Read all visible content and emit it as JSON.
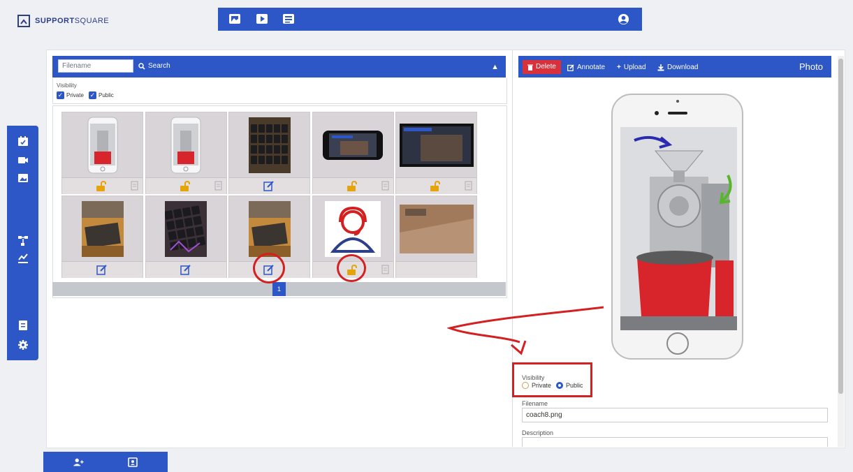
{
  "brand": {
    "name_bold": "SUPPORT",
    "name_light": "SQUARE"
  },
  "topbar": {
    "icons": [
      "gallery-icon",
      "video-icon",
      "documents-icon"
    ],
    "user_icon": "user-circle-icon"
  },
  "sidebar": {
    "icons": [
      "calendar-icon",
      "camera-icon",
      "gallery-icon",
      "workflow-icon",
      "chart-icon",
      "document-icon",
      "gear-icon"
    ]
  },
  "bottombar": {
    "icons": [
      "add-user-icon",
      "contacts-icon"
    ]
  },
  "search": {
    "placeholder": "Filename",
    "button_label": "Search"
  },
  "visibility_filter": {
    "label": "Visibility",
    "options": [
      {
        "label": "Private",
        "checked": true
      },
      {
        "label": "Public",
        "checked": true
      }
    ]
  },
  "gallery": {
    "tiles": [
      {
        "thumb": "phone-roaster",
        "footer": "lock-doc"
      },
      {
        "thumb": "phone-roaster",
        "footer": "lock-doc"
      },
      {
        "thumb": "keyboard",
        "footer": "edit"
      },
      {
        "thumb": "phone-landscape",
        "footer": "lock-doc"
      },
      {
        "thumb": "screen-landscape",
        "footer": "lock-doc"
      },
      {
        "thumb": "desk-photo",
        "footer": "edit"
      },
      {
        "thumb": "keyboard-annotated",
        "footer": "edit"
      },
      {
        "thumb": "desk-photo",
        "footer": "edit"
      },
      {
        "thumb": "support-avatar",
        "footer": "lock-doc"
      },
      {
        "thumb": "floor-photo",
        "footer": "none"
      }
    ],
    "page": "1"
  },
  "toolbar": {
    "delete": "Delete",
    "annotate": "Annotate",
    "upload": "Upload",
    "download": "Download",
    "title": "Photo"
  },
  "detail": {
    "visibility_label": "Visibility",
    "private_label": "Private",
    "public_label": "Public",
    "selected": "Public",
    "filename_label": "Filename",
    "filename_value": "coach8.png",
    "description_label": "Description"
  },
  "colors": {
    "primary": "#2d57c6",
    "delete": "#d9313b",
    "lock": "#e5a50a",
    "annotation": "#d42020"
  }
}
